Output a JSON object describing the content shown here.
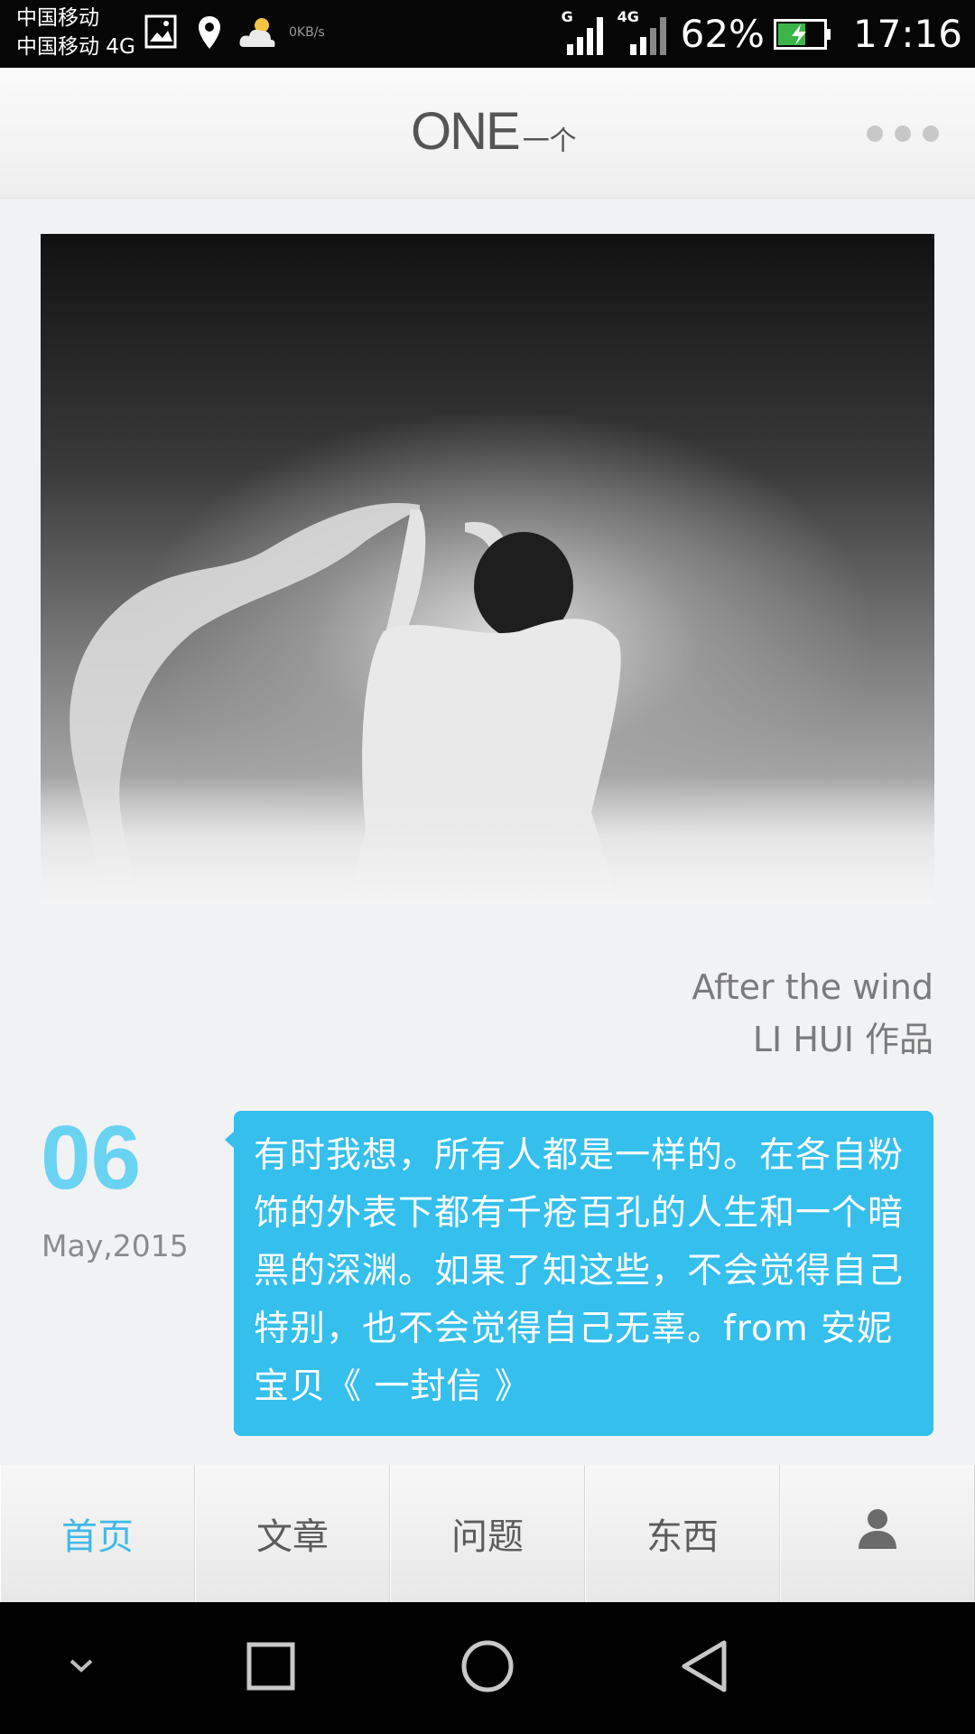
{
  "status_bar": {
    "carrier_1": "中国移动",
    "carrier_2": "中国移动 4G",
    "net_speed": "0KB/s",
    "sim1_type": "G",
    "sim2_type": "4G",
    "battery_percent": "62%",
    "battery_level": 0.62,
    "time": "17:16"
  },
  "header": {
    "logo_text": "ONE",
    "logo_cn": "一个"
  },
  "photo": {
    "title": "After the wind",
    "author": "LI HUI 作品"
  },
  "date": {
    "day": "06",
    "month_year": "May,2015"
  },
  "quote": {
    "text": "有时我想，所有人都是一样的。在各自粉饰的外表下都有千疮百孔的人生和一个暗黑的深渊。如果了知这些，不会觉得自己特别，也不会觉得自己无辜。from 安妮宝贝《 一封信 》"
  },
  "tabs": [
    {
      "label": "首页",
      "active": true
    },
    {
      "label": "文章",
      "active": false
    },
    {
      "label": "问题",
      "active": false
    },
    {
      "label": "东西",
      "active": false
    },
    {
      "icon": "person-icon",
      "active": false
    }
  ],
  "colors": {
    "accent": "#35bfed",
    "date_accent": "#6ad3f2",
    "active_tab": "#3fb9e9"
  }
}
